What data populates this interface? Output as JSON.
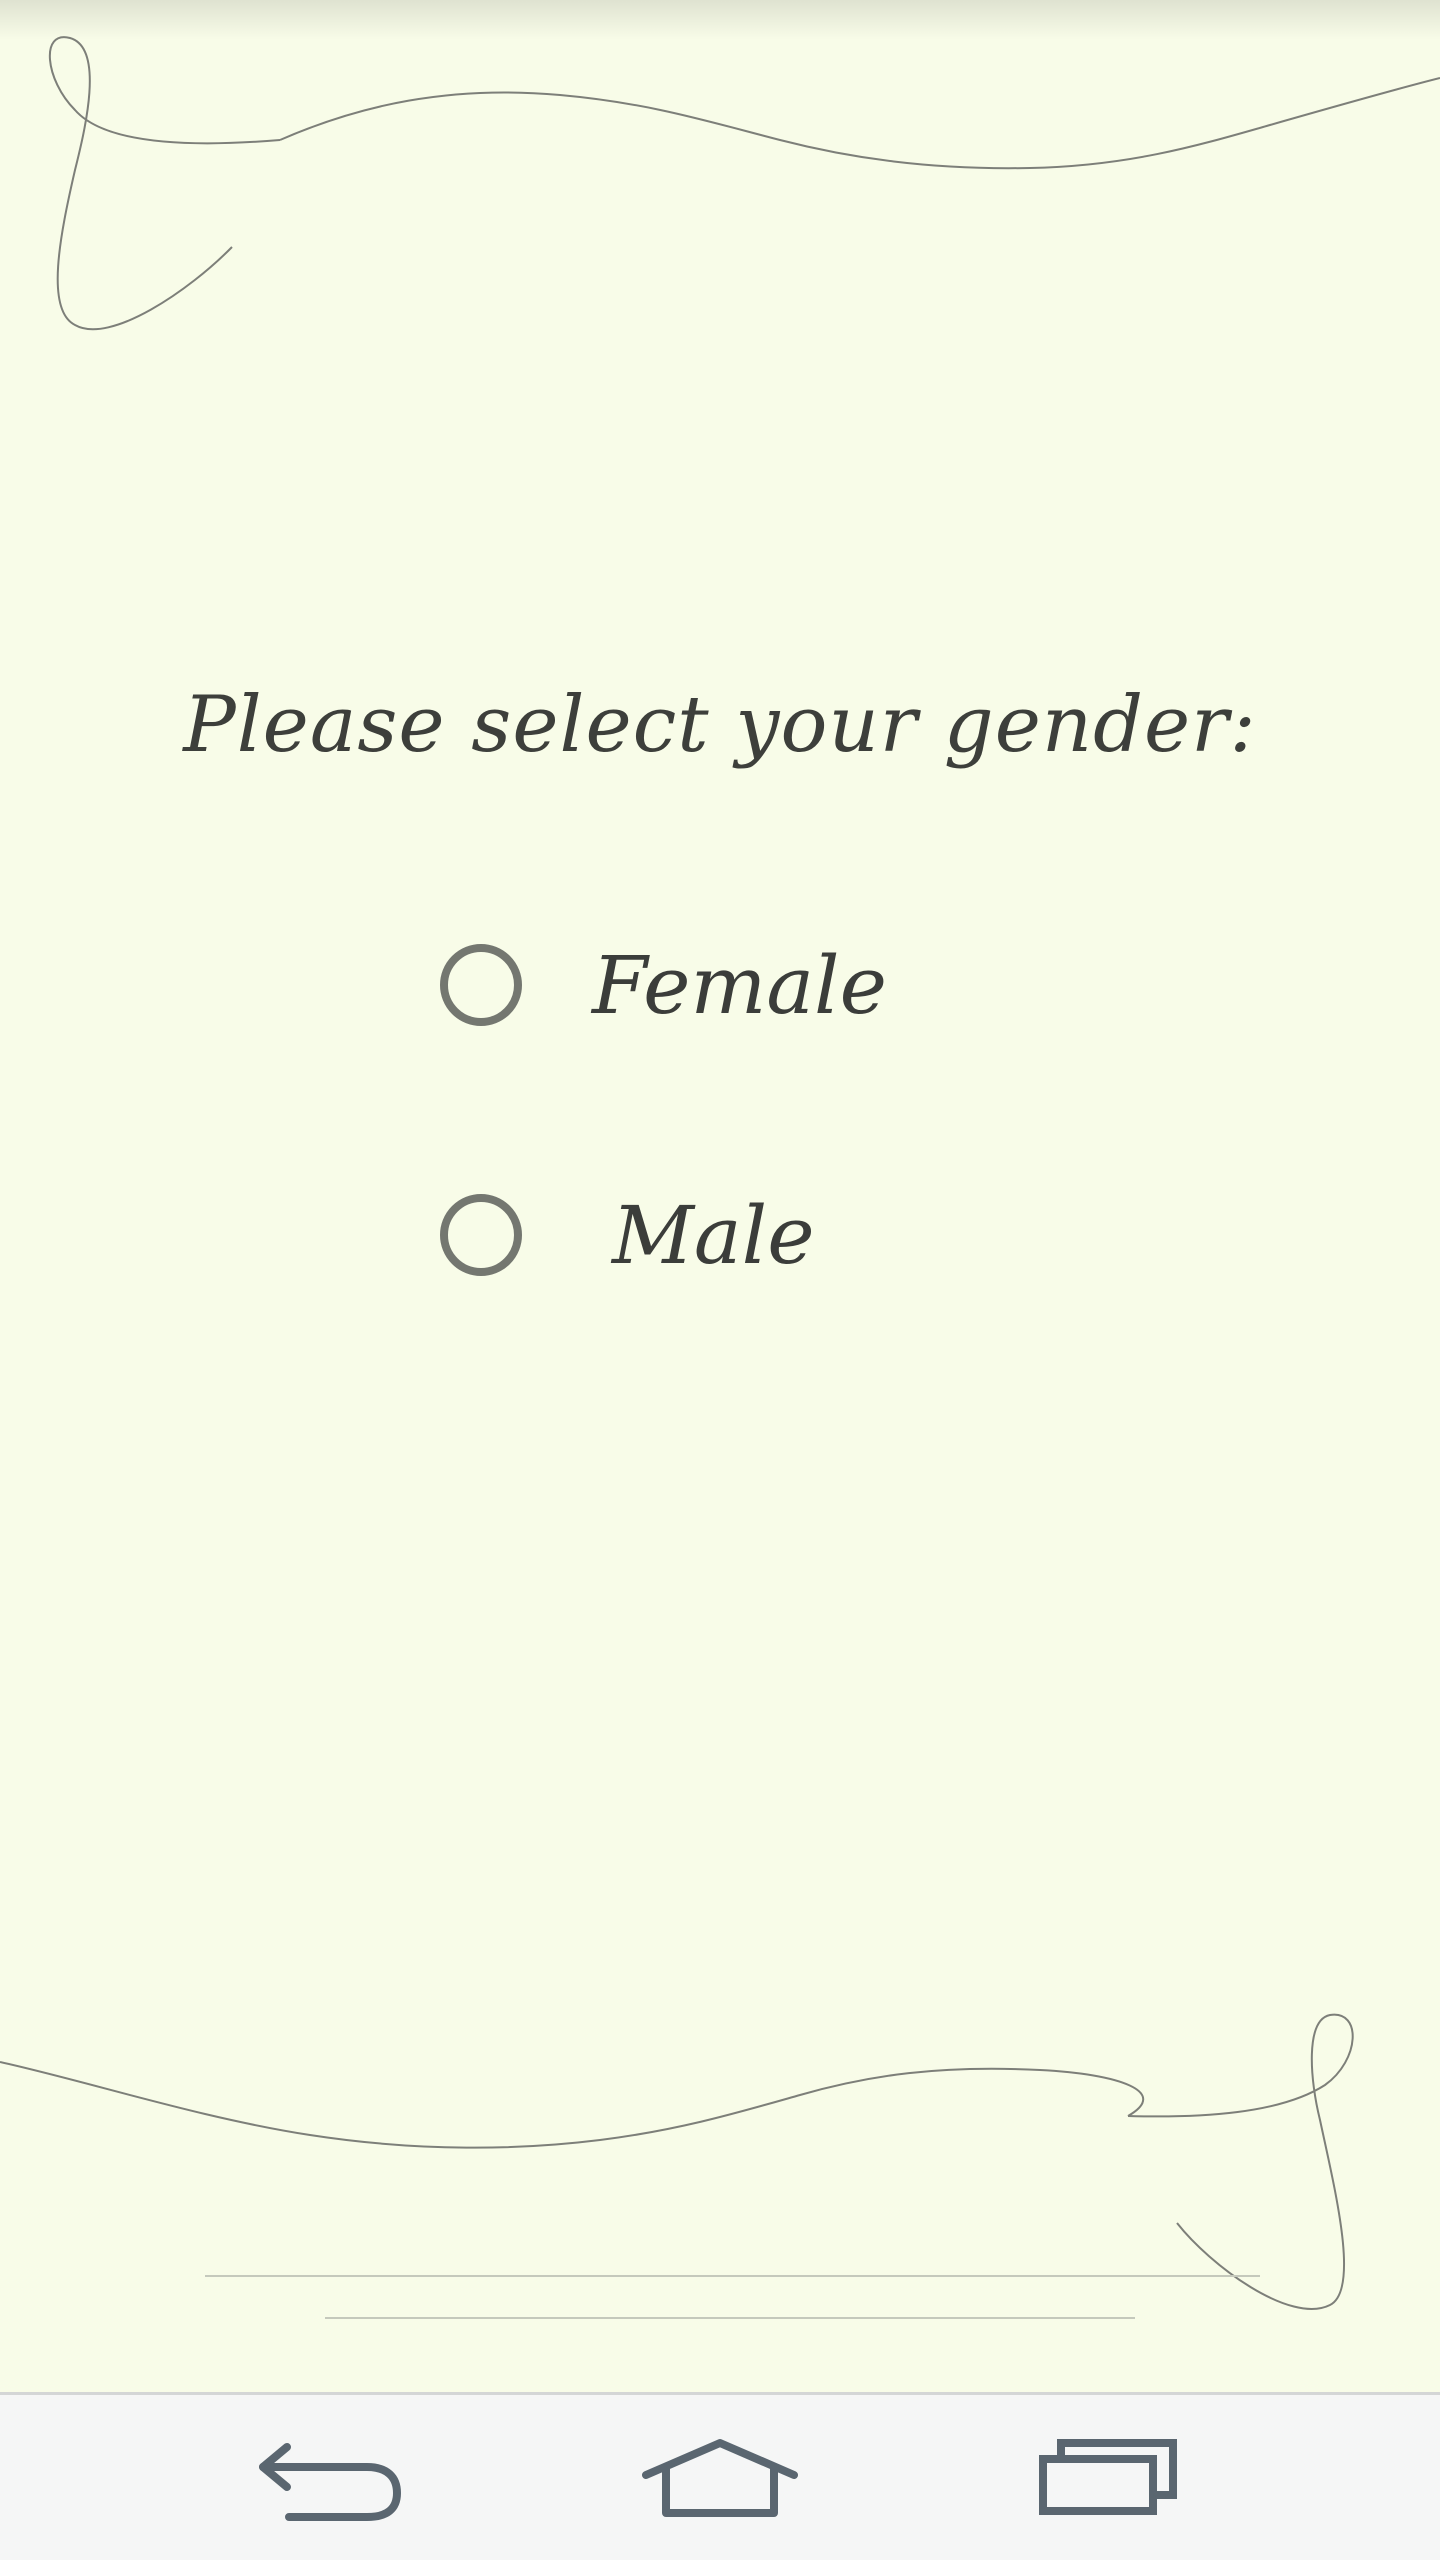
{
  "prompt": {
    "text": "Please select your gender:"
  },
  "options": [
    {
      "label": "Female",
      "selected": false
    },
    {
      "label": "Male",
      "selected": false
    }
  ],
  "navbar": {
    "back_icon": "back-icon",
    "home_icon": "home-icon",
    "recents_icon": "recents-icon"
  },
  "colors": {
    "background": "#f8fce8",
    "text": "#3b3d3a",
    "radio_border": "#747770",
    "nav_icon": "#5a6670",
    "navbar_bg": "#f5f6f6"
  }
}
